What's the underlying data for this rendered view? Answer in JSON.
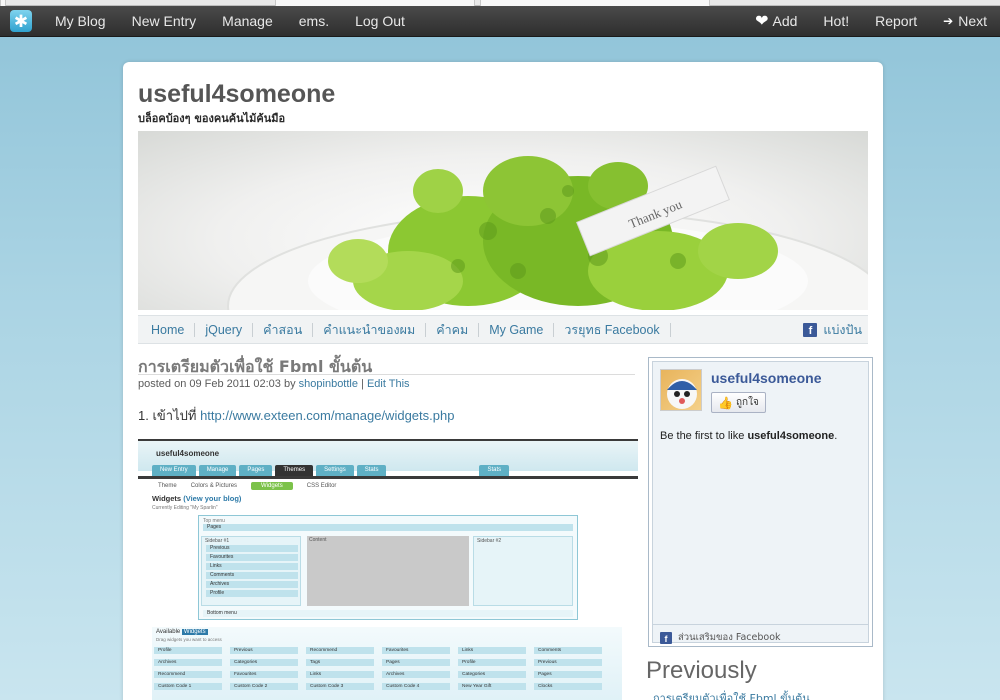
{
  "toolbar": {
    "links": [
      "My Blog",
      "New Entry",
      "Manage",
      "ems.",
      "Log Out"
    ],
    "right": {
      "add": "Add",
      "hot": "Hot!",
      "report": "Report",
      "next": "Next"
    }
  },
  "blog": {
    "title": "useful4someone",
    "tagline": "บล็อคบ้องๆ ของคนค้นไม้ค้นมือ",
    "banner_text": "Thank you"
  },
  "nav": {
    "items": [
      "Home",
      "jQuery",
      "คำสอน",
      "คำแนะนำของผม",
      "คำคม",
      "My Game",
      "วรยุทธ Facebook"
    ],
    "share": "แบ่งปัน"
  },
  "post": {
    "title": "การเตรียมตัวเพื่อใช้ Fbml ขั้นต้น",
    "meta_prefix": "posted on 09 Feb 2011 02:03 by",
    "author": "shopinbottle",
    "separator": "|",
    "edit": "Edit This",
    "step_text": "1. เข้าไปที่",
    "step_link": "http://www.exteen.com/manage/widgets.php"
  },
  "screenshot": {
    "title": "useful4someone",
    "tabs": [
      "New Entry",
      "Manage",
      "Pages",
      "Themes",
      "Settings",
      "Stats"
    ],
    "right_tab": "Stats",
    "subnav": [
      "Theme",
      "Colors & Pictures",
      "Widgets",
      "CSS Editor"
    ],
    "widgets_heading": "Widgets",
    "view_blog": "(View your blog)",
    "editing": "Currently Editing \"My Sparlin\"",
    "top_menu": "Top menu",
    "pages": "Pages",
    "sidebar_label": "Sidebar #1",
    "items": [
      "Previous",
      "Favourites",
      "Links",
      "Comments",
      "Archives",
      "Profile"
    ],
    "content_label": "Content",
    "sidebar2_label": "Sidebar #2",
    "bottom_menu": "Bottom menu",
    "available": "Available",
    "widgets_word": "Widgets",
    "drag_hint": "Drag widgets you want to access",
    "grid": [
      [
        "Profile",
        "Previous",
        "Recommend",
        "Favourites",
        "Links",
        "Comments"
      ],
      [
        "Archives",
        "Categories",
        "Tags",
        "Pages",
        "Profile",
        "Previous"
      ],
      [
        "Recommend",
        "Favourites",
        "Links",
        "Archives",
        "Categories",
        "Pages"
      ],
      [
        "Custom Code 1",
        "Custom Code 2",
        "Custom Code 3",
        "Custom Code 4",
        "New Year Gift",
        "Clocks"
      ]
    ]
  },
  "sidebar": {
    "page_name": "useful4someone",
    "like_label": "ถูกใจ",
    "first_like_prefix": "Be the first to like",
    "first_like_name": "useful4someone",
    "first_like_suffix": ".",
    "footer": "ส่วนเสริมของ Facebook"
  },
  "previously": {
    "heading": "Previously",
    "link": "การเตรียมตัวเพื่อใช้ Fbml ขั้นต้น"
  },
  "colors": {
    "toolbar": "#333333",
    "link": "#3a7aa0",
    "facebook": "#3b5998",
    "background": "#a9d3e3"
  }
}
